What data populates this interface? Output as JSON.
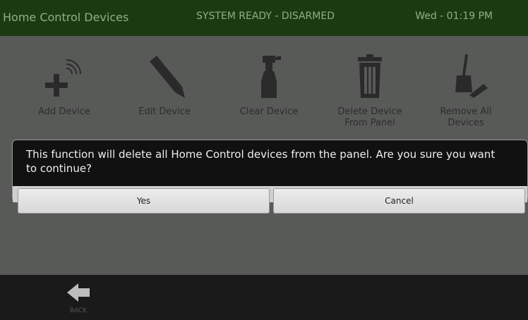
{
  "header": {
    "title": "Home Control Devices",
    "status": "SYSTEM READY - DISARMED",
    "datetime": "Wed - 01:19 PM"
  },
  "toolbar": {
    "items": [
      {
        "label": "Add Device",
        "icon": "add-device-icon"
      },
      {
        "label": "Edit Device",
        "icon": "pencil-icon"
      },
      {
        "label": "Clear Device",
        "icon": "spray-bottle-icon"
      },
      {
        "label": "Delete Device From Panel",
        "icon": "trash-can-icon"
      },
      {
        "label": "Remove All Devices",
        "icon": "broom-dustpan-icon"
      }
    ]
  },
  "dialog": {
    "message": "This function will delete all Home Control devices from the panel. Are you sure you want to continue?",
    "yes_label": "Yes",
    "cancel_label": "Cancel"
  },
  "footer": {
    "back_label": "BACK"
  }
}
